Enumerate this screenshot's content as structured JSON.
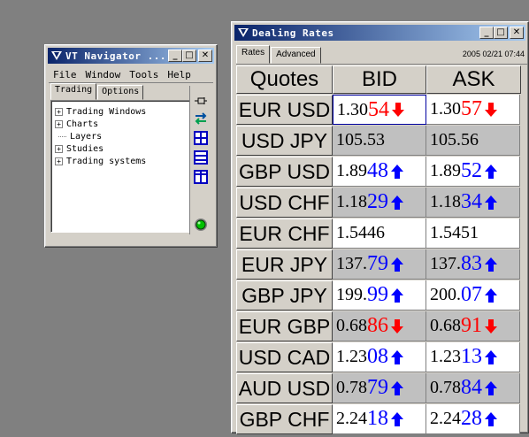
{
  "navigator": {
    "title": "VT Navigator ...",
    "menu": [
      "File",
      "Window",
      "Tools",
      "Help"
    ],
    "tabs": [
      "Trading",
      "Options"
    ],
    "tree": [
      {
        "label": "Trading Windows",
        "expandable": true
      },
      {
        "label": "Charts",
        "expandable": true
      },
      {
        "label": "Layers",
        "expandable": false
      },
      {
        "label": "Studies",
        "expandable": true
      },
      {
        "label": "Trading systems",
        "expandable": true
      }
    ],
    "side_icons": [
      "pin-icon",
      "swap-arrows-icon",
      "grid-layout-icon",
      "horizontal-split-icon",
      "vertical-split-icon",
      "status-indicator-icon"
    ]
  },
  "dealing_rates": {
    "title": "Dealing Rates",
    "tabs": [
      "Rates",
      "Advanced"
    ],
    "timestamp": "2005 02/21 07:44",
    "headers": {
      "quotes": "Quotes",
      "bid": "BID",
      "ask": "ASK"
    },
    "colors": {
      "up": "#0000ff",
      "down": "#ff0000",
      "row_alt": "#c0c0c0",
      "row_white": "#ffffff"
    },
    "rows": [
      {
        "symbol": "EUR USD",
        "bid_big": "1.30",
        "bid_pip": "54",
        "ask_big": "1.30",
        "ask_pip": "57",
        "direction": "down",
        "shade": "white"
      },
      {
        "symbol": "USD JPY",
        "bid_big": "105.53",
        "bid_pip": "",
        "ask_big": "105.56",
        "ask_pip": "",
        "direction": "none",
        "shade": "alt"
      },
      {
        "symbol": "GBP USD",
        "bid_big": "1.89",
        "bid_pip": "48",
        "ask_big": "1.89",
        "ask_pip": "52",
        "direction": "up",
        "shade": "white"
      },
      {
        "symbol": "USD CHF",
        "bid_big": "1.18",
        "bid_pip": "29",
        "ask_big": "1.18",
        "ask_pip": "34",
        "direction": "up",
        "shade": "alt"
      },
      {
        "symbol": "EUR CHF",
        "bid_big": "1.5446",
        "bid_pip": "",
        "ask_big": "1.5451",
        "ask_pip": "",
        "direction": "none",
        "shade": "white"
      },
      {
        "symbol": "EUR JPY",
        "bid_big": "137.",
        "bid_pip": "79",
        "ask_big": "137.",
        "ask_pip": "83",
        "direction": "up",
        "shade": "alt"
      },
      {
        "symbol": "GBP JPY",
        "bid_big": "199.",
        "bid_pip": "99",
        "ask_big": "200.",
        "ask_pip": "07",
        "direction": "up",
        "shade": "white"
      },
      {
        "symbol": "EUR GBP",
        "bid_big": "0.68",
        "bid_pip": "86",
        "ask_big": "0.68",
        "ask_pip": "91",
        "direction": "down",
        "shade": "alt"
      },
      {
        "symbol": "USD CAD",
        "bid_big": "1.23",
        "bid_pip": "08",
        "ask_big": "1.23",
        "ask_pip": "13",
        "direction": "up",
        "shade": "white"
      },
      {
        "symbol": "AUD USD",
        "bid_big": "0.78",
        "bid_pip": "79",
        "ask_big": "0.78",
        "ask_pip": "84",
        "direction": "up",
        "shade": "alt"
      },
      {
        "symbol": "GBP CHF",
        "bid_big": "2.24",
        "bid_pip": "18",
        "ask_big": "2.24",
        "ask_pip": "28",
        "direction": "up",
        "shade": "white"
      }
    ]
  }
}
